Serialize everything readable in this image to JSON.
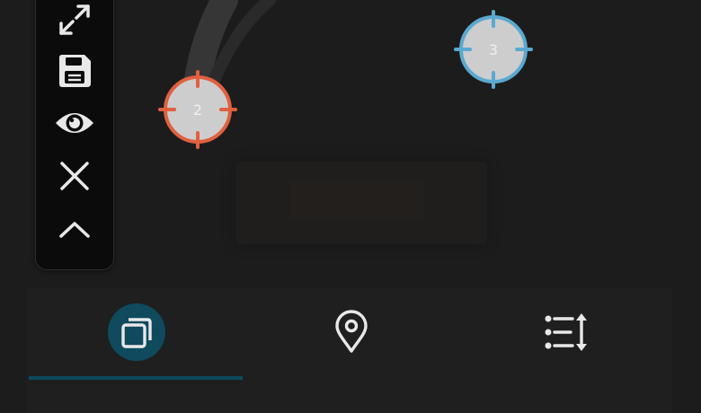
{
  "map": {
    "markers": [
      {
        "label": "2",
        "color": "#e0603f"
      },
      {
        "label": "3",
        "color": "#5aa9d0"
      }
    ],
    "path_color": "#3a3a3a"
  },
  "toolbar": {
    "tools": [
      {
        "icon": "expand-icon"
      },
      {
        "icon": "save-icon"
      },
      {
        "icon": "eye-icon"
      },
      {
        "icon": "close-icon"
      },
      {
        "icon": "chevron-up-icon"
      }
    ]
  },
  "tabs": [
    {
      "icon": "layers-icon",
      "active": true
    },
    {
      "icon": "location-pin-icon",
      "active": false
    },
    {
      "icon": "sort-list-icon",
      "active": false
    }
  ],
  "colors": {
    "accent": "#0f4a5e",
    "background": "#1c1c1c",
    "toolbar": "#0b0b0b",
    "icon": "#e8e8e8"
  }
}
